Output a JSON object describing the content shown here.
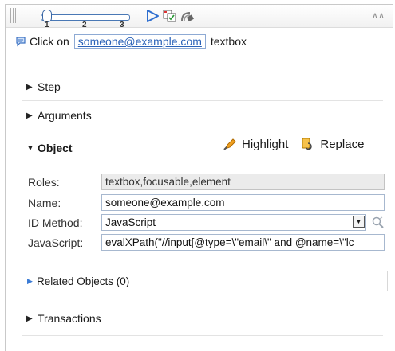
{
  "toolbar": {
    "slider_ticks": [
      "1",
      "2",
      "3"
    ],
    "slider_value": 1,
    "icons": [
      "grip-icon",
      "play-icon",
      "record-icon",
      "satellite-icon",
      "collapse-icon"
    ]
  },
  "step_line": {
    "prefix": "Click on",
    "target": "someone@example.com",
    "suffix": "textbox"
  },
  "sections": {
    "step": "Step",
    "arguments": "Arguments",
    "object": "Object",
    "related": "Related Objects (0)",
    "transactions": "Transactions"
  },
  "object_actions": {
    "highlight": "Highlight",
    "replace": "Replace"
  },
  "fields": {
    "roles_label": "Roles:",
    "roles_value": "textbox,focusable,element",
    "name_label": "Name:",
    "name_value": "someone@example.com",
    "id_method_label": "ID Method:",
    "id_method_value": "JavaScript",
    "javascript_label": "JavaScript:",
    "javascript_value": "evalXPath(\"//input[@type=\\\"email\\\" and @name=\\\"lc"
  },
  "colors": {
    "accent_blue": "#2a62b8",
    "field_border": "#a7b8cf",
    "readonly_bg": "#ebebeb"
  }
}
